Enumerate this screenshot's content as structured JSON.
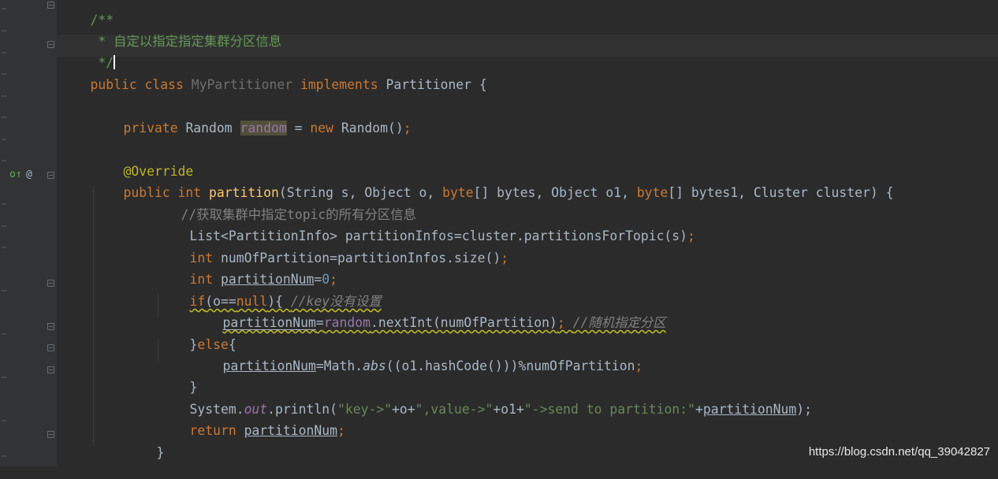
{
  "editor": {
    "lines": {
      "l1": [
        "/**"
      ],
      "l2": [
        " * ",
        "自定以指定指定集群分区信息"
      ],
      "l3": [
        " */"
      ],
      "l4": [
        "public class ",
        "MyPartitioner",
        " implements ",
        "Partitioner {"
      ],
      "l6": [
        "private ",
        "Random ",
        "random",
        " = ",
        "new ",
        "Random()",
        ";"
      ],
      "l8": [
        "@Override"
      ],
      "l9": [
        "public int ",
        "partition",
        "(String s, Object o, ",
        "byte",
        "[] bytes, Object o1, ",
        "byte",
        "[] bytes1, Cluster cluster) {"
      ],
      "l10": [
        "//获取集群中指定topic的所有分区信息"
      ],
      "l11": [
        "List<PartitionInfo> partitionInfos=cluster.partitionsForTopic(s)",
        ";"
      ],
      "l12": [
        "int ",
        "numOfPartition=partitionInfos.size()",
        ";"
      ],
      "l13": [
        "int ",
        "partitionNum",
        "=",
        "0",
        ";"
      ],
      "l14": [
        "if",
        "(o==",
        "null",
        "){ ",
        "//key没有设置"
      ],
      "l15": [
        "partitionNum",
        "=",
        "random",
        ".nextInt(numOfPartition)",
        "; ",
        "//随机指定分区"
      ],
      "l16": [
        "}",
        "else",
        "{"
      ],
      "l17": [
        "partitionNum",
        "=Math.",
        "abs",
        "((o1.hashCode()))%numOfPartition",
        ";"
      ],
      "l18": [
        "}"
      ],
      "l19": [
        "System.",
        "out",
        ".println(",
        "\"key->\"",
        "+o+",
        "\",value->\"",
        "+o1+",
        "\"->send to partition:\"",
        "+",
        "partitionNum",
        ");"
      ],
      "l20": [
        "return ",
        "partitionNum",
        ";"
      ],
      "l21": [
        "}"
      ]
    },
    "gutter": {
      "override_marker": "o↑",
      "at_marker": "@"
    }
  },
  "watermark": "https://blog.csdn.net/qq_39042827",
  "colors": {
    "background": "#2b2b2b",
    "keyword": "#cc7832",
    "doc_comment": "#629755",
    "method": "#ffc66d",
    "annotation": "#bbb529",
    "string": "#6a8759",
    "number": "#6897bb",
    "field": "#9876aa"
  }
}
